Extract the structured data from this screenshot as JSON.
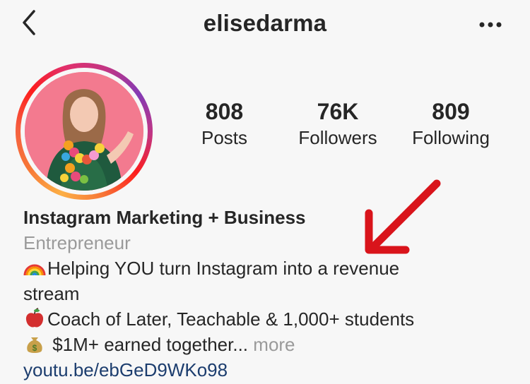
{
  "header": {
    "username": "elisedarma",
    "back_icon": "chevron-left-icon",
    "more_icon": "ellipsis-icon"
  },
  "stats": [
    {
      "value": "808",
      "label": "Posts"
    },
    {
      "value": "76K",
      "label": "Followers"
    },
    {
      "value": "809",
      "label": "Following"
    }
  ],
  "bio": {
    "name": "Instagram Marketing + Business",
    "category": "Entrepreneur",
    "line1_emoji": "rainbow-icon",
    "line1": "Helping YOU turn Instagram into a revenue",
    "line1_cont": "stream",
    "line2_emoji": "apple-icon",
    "line2": "Coach of Later, Teachable & 1,000+ students",
    "line3_emoji": "money-bag-icon",
    "line3": " $1M+ earned together...",
    "more": "more",
    "link": "youtu.be/ebGeD9WKo98"
  },
  "colors": {
    "text": "#262626",
    "secondary": "#9a9a9a",
    "link": "#1c3d6e",
    "annotation_arrow": "#d9141b",
    "background": "#f7f7f7"
  }
}
